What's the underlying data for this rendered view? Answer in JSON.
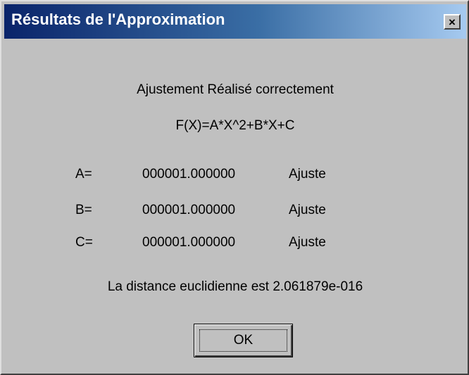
{
  "window": {
    "title": "Résultats de l'Approximation",
    "close_label": "×"
  },
  "dialog": {
    "status_message": "Ajustement Réalisé correctement",
    "formula": "F(X)=A*X^2+B*X+C",
    "parameters": [
      {
        "name": "A=",
        "value": "000001.000000",
        "status": "Ajuste"
      },
      {
        "name": "B=",
        "value": "000001.000000",
        "status": "Ajuste"
      },
      {
        "name": "C=",
        "value": "000001.000000",
        "status": "Ajuste"
      }
    ],
    "distance_message": "La distance euclidienne est 2.061879e-016",
    "ok_label": "OK"
  },
  "colors": {
    "title_gradient_start": "#0a246a",
    "title_gradient_end": "#a6caf0",
    "face": "#c0c0c0"
  }
}
